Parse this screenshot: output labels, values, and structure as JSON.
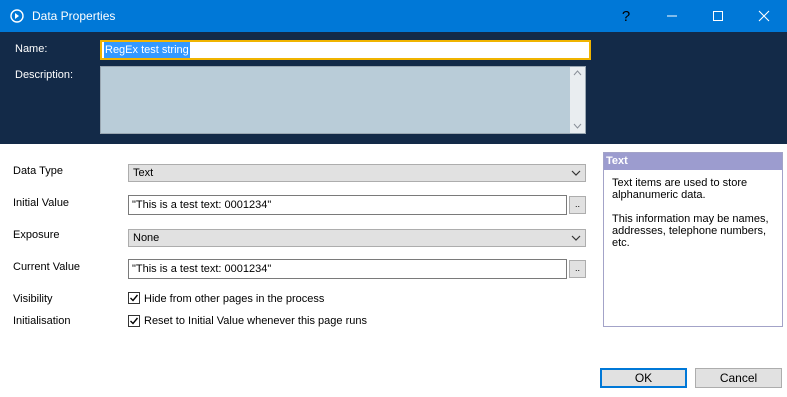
{
  "window": {
    "title": "Data Properties",
    "help_glyph": "?"
  },
  "header": {
    "name_label": "Name:",
    "name_value": "RegEx test string",
    "description_label": "Description:",
    "description_value": ""
  },
  "form": {
    "data_type": {
      "label": "Data Type",
      "value": "Text"
    },
    "initial_value": {
      "label": "Initial Value",
      "value": "\"This is a test text: 0001234\"",
      "button": ".."
    },
    "exposure": {
      "label": "Exposure",
      "value": "None"
    },
    "current_value": {
      "label": "Current Value",
      "value": "\"This is a test text: 0001234\"",
      "button": ".."
    },
    "visibility": {
      "label": "Visibility",
      "checkbox_label": "Hide from other pages in the process",
      "checked": true
    },
    "initialisation": {
      "label": "Initialisation",
      "checkbox_label": "Reset to Initial Value whenever this page runs",
      "checked": true
    }
  },
  "help": {
    "title": "Text",
    "paragraph1": "Text items are used to store alphanumeric data.",
    "paragraph2": "This information may be names, addresses, telephone numbers, etc."
  },
  "buttons": {
    "ok": "OK",
    "cancel": "Cancel"
  },
  "colors": {
    "titlebar": "#0078d7",
    "header": "#132a48",
    "name_focus_border": "#f0b400",
    "help_title": "#9c9ccf"
  }
}
